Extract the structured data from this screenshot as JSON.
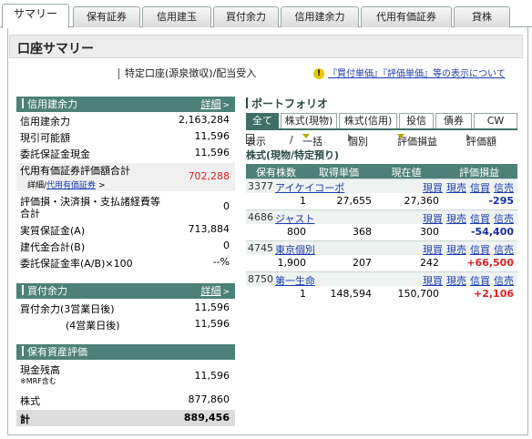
{
  "tabs": [
    {
      "label": "サマリー",
      "active": true
    },
    {
      "label": "保有証券"
    },
    {
      "label": "信用建玉"
    },
    {
      "label": "買付余力"
    },
    {
      "label": "信用建余力"
    },
    {
      "label": "代用有価証券"
    },
    {
      "label": "貸株"
    }
  ],
  "page_title": "口座サマリー",
  "account_type": "特定口座(源泉徴収)/配当受入",
  "notice": {
    "icon": "warning-icon",
    "text": "『買付単価』『評価単価』等の表示について"
  },
  "colors": {
    "section_header": "#4d8177",
    "positive": "#e02020",
    "negative": "#1530a8",
    "link": "#1a3cb0"
  },
  "margin": {
    "header": "信用建余力",
    "detail": "詳細",
    "rows": [
      {
        "label": "信用建余力",
        "value": "2,163,284"
      },
      {
        "label": "現引可能額",
        "value": "11,596"
      },
      {
        "label": "委託保証金現金",
        "value": "11,596"
      },
      {
        "label": "代用有価証券評価額合計",
        "value": "702,288",
        "sub_prefix": "詳細/",
        "sub_link": "代用有価証券"
      },
      {
        "label": "評価損・決済損・支払諸経費等",
        "label2": "合計",
        "value": "0"
      },
      {
        "label": "実質保証金(A)",
        "value": "713,884"
      },
      {
        "label": "建代金合計(B)",
        "value": "0"
      },
      {
        "label": "委託保証金率(A/B)×100",
        "value": "--%"
      }
    ]
  },
  "buying_power": {
    "header": "買付余力",
    "detail": "詳細",
    "rows": [
      {
        "label": "買付余力(3営業日後)",
        "value": "11,596"
      },
      {
        "label": "(4営業日後)",
        "value": "11,596"
      }
    ]
  },
  "assets": {
    "header": "保有資産評価",
    "rows": [
      {
        "label": "現金残高",
        "sublabel": "※MRF含む",
        "value": "11,596"
      },
      {
        "label": "株式",
        "value": "877,860"
      },
      {
        "label": "計",
        "value": "889,456"
      }
    ]
  },
  "portfolio": {
    "title": "ポートフォリオ",
    "tabs": [
      "全て",
      "株式(現物)",
      "株式(信用)",
      "投信",
      "債券",
      "CW"
    ],
    "toolbar": {
      "display": "表示",
      "slash": "/",
      "bulk": "一括",
      "individual": "個別",
      "pl_sort": "評価損益",
      "eval_amount": "評価額"
    },
    "subtitle": "株式(現物/特定預り)",
    "columns": [
      "保有株数",
      "取得単価",
      "現在値",
      "評価損益"
    ],
    "link_labels": [
      "現買",
      "現売",
      "信買",
      "信売"
    ],
    "holdings": [
      {
        "code": "3377",
        "name": "アイケイコーポ",
        "shares": "1",
        "cost": "27,655",
        "price": "27,360",
        "pl": "-295",
        "sign": "neg"
      },
      {
        "code": "4686",
        "name": "ジャスト",
        "shares": "800",
        "cost": "368",
        "price": "300",
        "pl": "-54,400",
        "sign": "neg"
      },
      {
        "code": "4745",
        "name": "東京個別",
        "shares": "1,900",
        "cost": "207",
        "price": "242",
        "pl": "+66,500",
        "sign": "pos"
      },
      {
        "code": "8750",
        "name": "第一生命",
        "shares": "1",
        "cost": "148,594",
        "price": "150,700",
        "pl": "+2,106",
        "sign": "pos"
      }
    ]
  }
}
